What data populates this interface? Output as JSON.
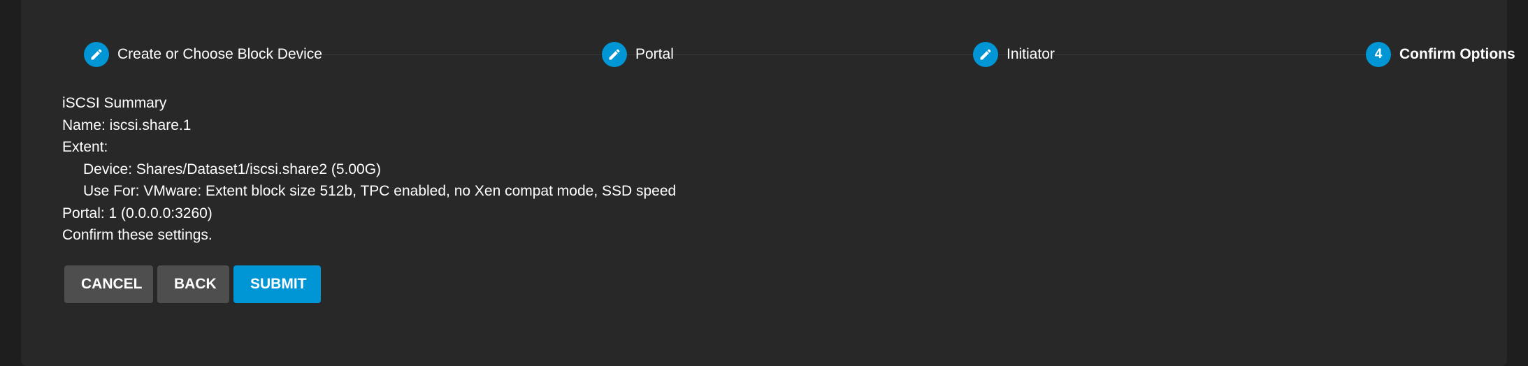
{
  "stepper": {
    "steps": [
      {
        "label": "Create or Choose Block Device",
        "marker": "",
        "icon": "pencil-icon",
        "state": "done"
      },
      {
        "label": "Portal",
        "marker": "",
        "icon": "pencil-icon",
        "state": "done"
      },
      {
        "label": "Initiator",
        "marker": "",
        "icon": "pencil-icon",
        "state": "done"
      },
      {
        "label": "Confirm Options",
        "marker": "4",
        "icon": "",
        "state": "active"
      }
    ]
  },
  "summary": {
    "heading": "iSCSI Summary",
    "name": "Name: iscsi.share.1",
    "extent_label": "Extent:",
    "device": "Device: Shares/Dataset1/iscsi.share2 (5.00G)",
    "use_for": "Use For: VMware: Extent block size 512b, TPC enabled, no Xen compat mode, SSD speed",
    "portal": "Portal: 1 (0.0.0.0:3260)",
    "confirm": "Confirm these settings."
  },
  "actions": {
    "cancel_label": "Cancel",
    "back_label": "Back",
    "submit_label": "Submit"
  },
  "colors": {
    "accent": "#0095d5",
    "background": "#1e1e1e",
    "card": "#282828",
    "secondary_button": "#4e4e4e"
  }
}
